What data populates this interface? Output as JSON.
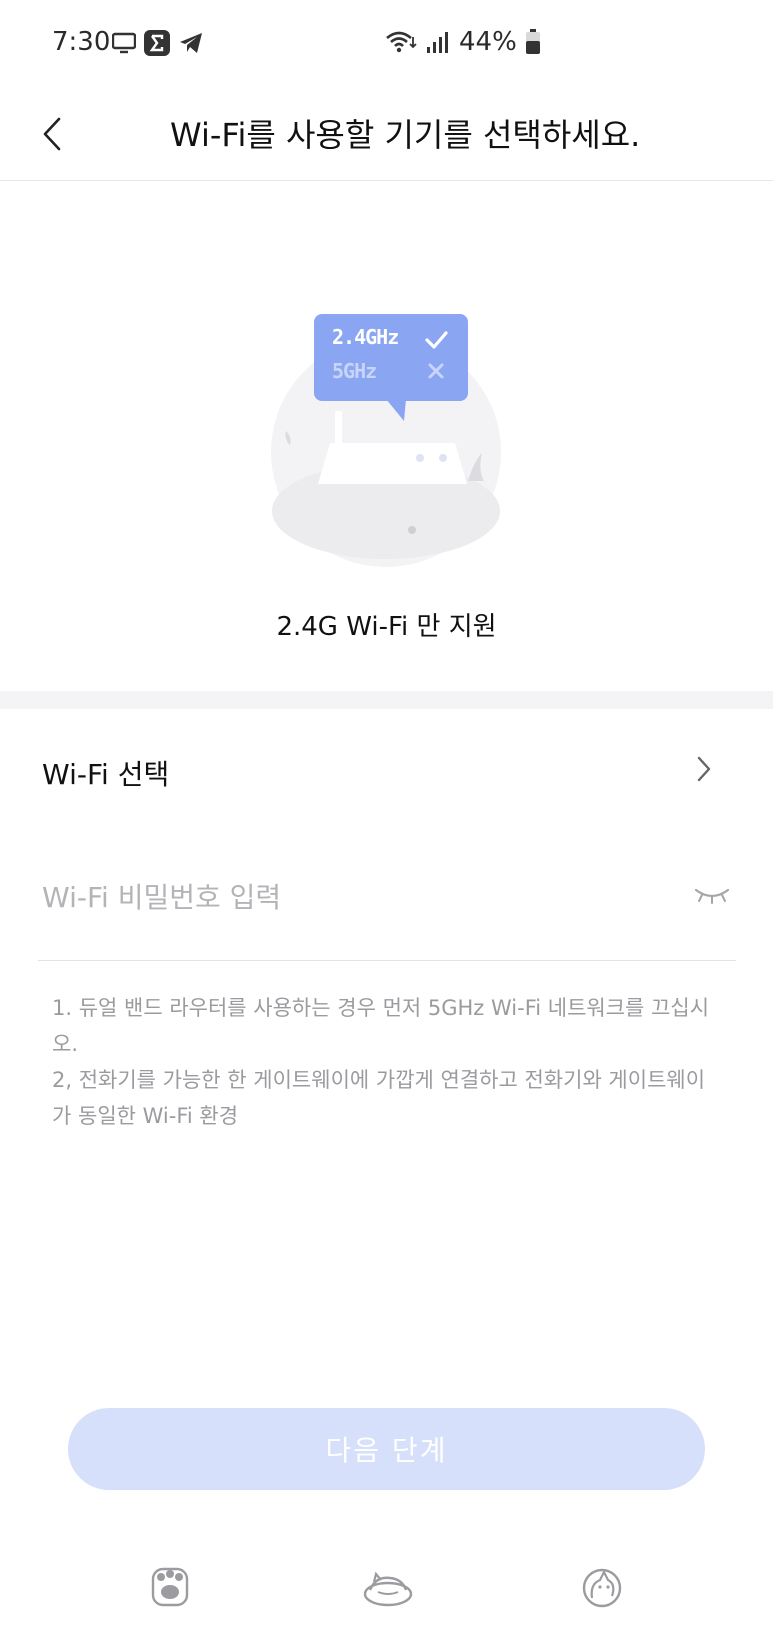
{
  "status_bar": {
    "time": "7:30",
    "battery_text": "44%",
    "icons": [
      "screen-cast-icon",
      "sigma-app-icon",
      "telegram-icon",
      "wifi-icon",
      "signal-icon",
      "battery-icon"
    ]
  },
  "header": {
    "title": "Wi-Fi를 사용할 기기를 선택하세요.",
    "back_icon": "back-chevron-icon"
  },
  "illustration": {
    "band_24": "2.4GHz",
    "band_5": "5GHz",
    "caption": "2.4G Wi-Fi 만 지원"
  },
  "form": {
    "wifi_select_label": "Wi-Fi 선택",
    "password_placeholder": "Wi-Fi 비밀번호 입력",
    "password_value": ""
  },
  "notes": {
    "line1": "1. 듀얼 밴드 라우터를 사용하는 경우 먼저 5GHz Wi-Fi 네트워크를 끄십시오.",
    "line2": "2, 전화기를 가능한 한 게이트웨이에 가깝게 연결하고 전화기와 게이트웨이가 동일한 Wi-Fi 환경"
  },
  "next_button": {
    "label": "다음 단계"
  },
  "bottom_nav": {
    "items": [
      "paw-icon",
      "cat-sleeping-icon",
      "cat-playing-icon"
    ]
  },
  "colors": {
    "accent_blue": "#8aa6f2",
    "next_button_disabled": "#d6e0fa",
    "placeholder_gray": "#b4b4b8",
    "section_gap": "#f4f4f6"
  }
}
